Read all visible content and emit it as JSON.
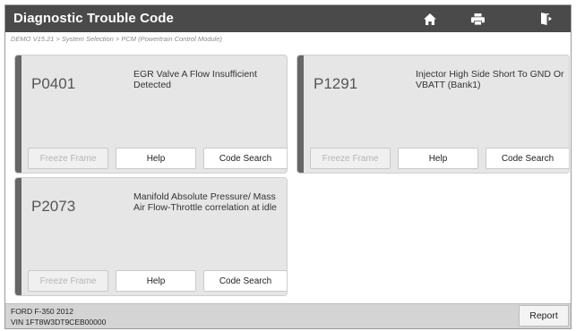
{
  "header": {
    "title": "Diagnostic Trouble Code",
    "buttons": [
      {
        "icon": "home-icon"
      },
      {
        "icon": "print-icon"
      },
      {
        "icon": "exit-icon"
      }
    ]
  },
  "breadcrumb": "DEMO V15.21 > System Selection > PCM (Powertrain Control Module)",
  "dtcs": [
    {
      "code": "P0401",
      "description": "EGR Valve A Flow Insufficient Detected",
      "freeze_frame": "Freeze Frame",
      "help": "Help",
      "code_search": "Code Search"
    },
    {
      "code": "P1291",
      "description": "Injector High Side Short To GND Or VBATT (Bank1)",
      "freeze_frame": "Freeze Frame",
      "help": "Help",
      "code_search": "Code Search"
    },
    {
      "code": "P2073",
      "description": "Manifold Absolute Pressure/ Mass Air Flow-Throttle correlation at idle",
      "freeze_frame": "Freeze Frame",
      "help": "Help",
      "code_search": "Code Search"
    }
  ],
  "footer": {
    "vehicle": "FORD F-350 2012",
    "vin": "VIN 1FT8W3DT9CEB00000",
    "report_label": "Report"
  },
  "colors": {
    "titlebar": "#4a4a4a",
    "card": "#e6e6e6",
    "accent": "#666666",
    "footer": "#d4d4d4"
  }
}
